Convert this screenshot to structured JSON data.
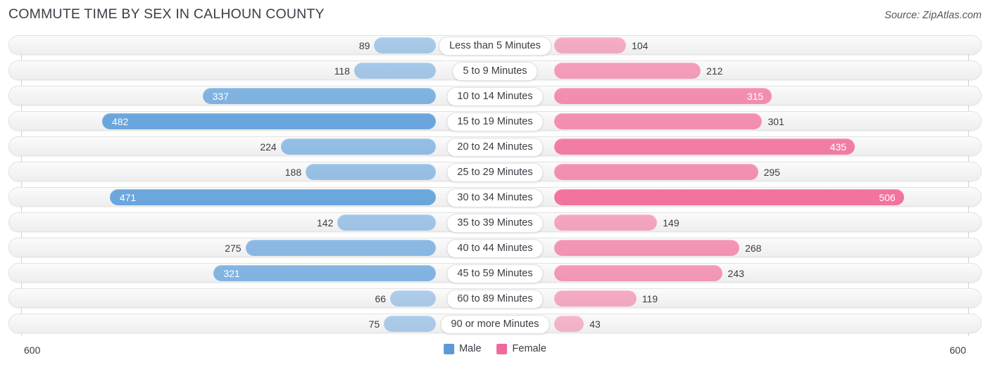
{
  "header": {
    "title": "COMMUTE TIME BY SEX IN CALHOUN COUNTY",
    "source": "Source: ZipAtlas.com"
  },
  "axis": {
    "left_max_label": "600",
    "right_max_label": "600",
    "max": 600
  },
  "legend": {
    "items": [
      {
        "label": "Male",
        "color": "#5b9bd5"
      },
      {
        "label": "Female",
        "color": "#f2689c"
      }
    ]
  },
  "colors": {
    "male": "#5b9bd5",
    "female": "#f2689c",
    "track": "#f4f4f5",
    "text": "#3b3b44"
  },
  "chart_data": {
    "type": "bar",
    "title": "COMMUTE TIME BY SEX IN CALHOUN COUNTY",
    "orientation": "horizontal-diverging",
    "xlabel": "",
    "ylabel": "",
    "xlim": [
      600,
      600
    ],
    "grid": false,
    "legend_position": "bottom-center",
    "categories": [
      "Less than 5 Minutes",
      "5 to 9 Minutes",
      "10 to 14 Minutes",
      "15 to 19 Minutes",
      "20 to 24 Minutes",
      "25 to 29 Minutes",
      "30 to 34 Minutes",
      "35 to 39 Minutes",
      "40 to 44 Minutes",
      "45 to 59 Minutes",
      "60 to 89 Minutes",
      "90 or more Minutes"
    ],
    "series": [
      {
        "name": "Male",
        "values": [
          89,
          118,
          337,
          482,
          224,
          188,
          471,
          142,
          275,
          321,
          66,
          75
        ]
      },
      {
        "name": "Female",
        "values": [
          104,
          212,
          315,
          301,
          435,
          295,
          506,
          149,
          268,
          243,
          119,
          43
        ]
      }
    ]
  },
  "rows": [
    {
      "label": "Less than 5 Minutes",
      "male": "89",
      "female": "104"
    },
    {
      "label": "5 to 9 Minutes",
      "male": "118",
      "female": "212"
    },
    {
      "label": "10 to 14 Minutes",
      "male": "337",
      "female": "315"
    },
    {
      "label": "15 to 19 Minutes",
      "male": "482",
      "female": "301"
    },
    {
      "label": "20 to 24 Minutes",
      "male": "224",
      "female": "435"
    },
    {
      "label": "25 to 29 Minutes",
      "male": "188",
      "female": "295"
    },
    {
      "label": "30 to 34 Minutes",
      "male": "471",
      "female": "506"
    },
    {
      "label": "35 to 39 Minutes",
      "male": "142",
      "female": "149"
    },
    {
      "label": "40 to 44 Minutes",
      "male": "275",
      "female": "268"
    },
    {
      "label": "45 to 59 Minutes",
      "male": "321",
      "female": "243"
    },
    {
      "label": "60 to 89 Minutes",
      "male": "66",
      "female": "119"
    },
    {
      "label": "90 or more Minutes",
      "male": "75",
      "female": "43"
    }
  ]
}
